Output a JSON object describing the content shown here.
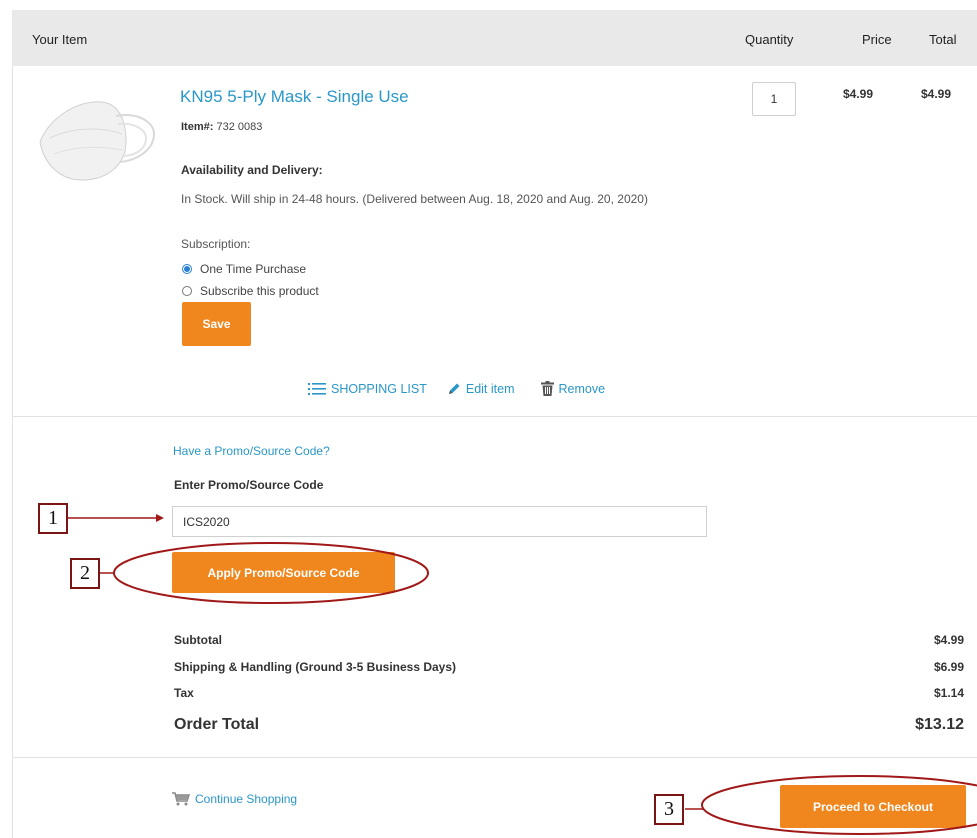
{
  "table_header": {
    "your_item": "Your Item",
    "quantity": "Quantity",
    "price": "Price",
    "total": "Total"
  },
  "item": {
    "name": "KN95 5-Ply Mask - Single Use",
    "item_number_label": "Item#:",
    "item_number": "732 0083",
    "quantity": "1",
    "price": "$4.99",
    "total": "$4.99",
    "availability_heading": "Availability and Delivery:",
    "availability_text": "In Stock. Will ship in 24-48 hours. (Delivered between Aug. 18, 2020 and Aug. 20, 2020)",
    "subscription_label": "Subscription:",
    "options": [
      {
        "label": "One Time Purchase",
        "selected": true
      },
      {
        "label": "Subscribe this product",
        "selected": false
      }
    ],
    "save_label": "Save",
    "actions": {
      "shopping_list": "SHOPPING LIST",
      "edit": "Edit item",
      "remove": "Remove"
    }
  },
  "promo": {
    "toggle_link": "Have a Promo/Source Code?",
    "label": "Enter Promo/Source Code",
    "value": "ICS2020",
    "apply_label": "Apply Promo/Source Code"
  },
  "summary": {
    "subtotal_label": "Subtotal",
    "subtotal": "$4.99",
    "shipping_label": "Shipping & Handling (Ground 3-5 Business Days)",
    "shipping": "$6.99",
    "tax_label": "Tax",
    "tax": "$1.14",
    "order_total_label": "Order Total",
    "order_total": "$13.12"
  },
  "footer": {
    "continue_shopping": "Continue Shopping",
    "checkout_label": "Proceed to Checkout"
  },
  "annotations": {
    "callout_1": "1",
    "callout_2": "2",
    "callout_3": "3"
  },
  "colors": {
    "accent_orange": "#f0861e",
    "link_blue": "#2a97c9",
    "annotation_red": "#a01818"
  },
  "icons": [
    "mask-product-image",
    "list-icon",
    "pencil-icon",
    "trash-icon",
    "cart-icon"
  ]
}
